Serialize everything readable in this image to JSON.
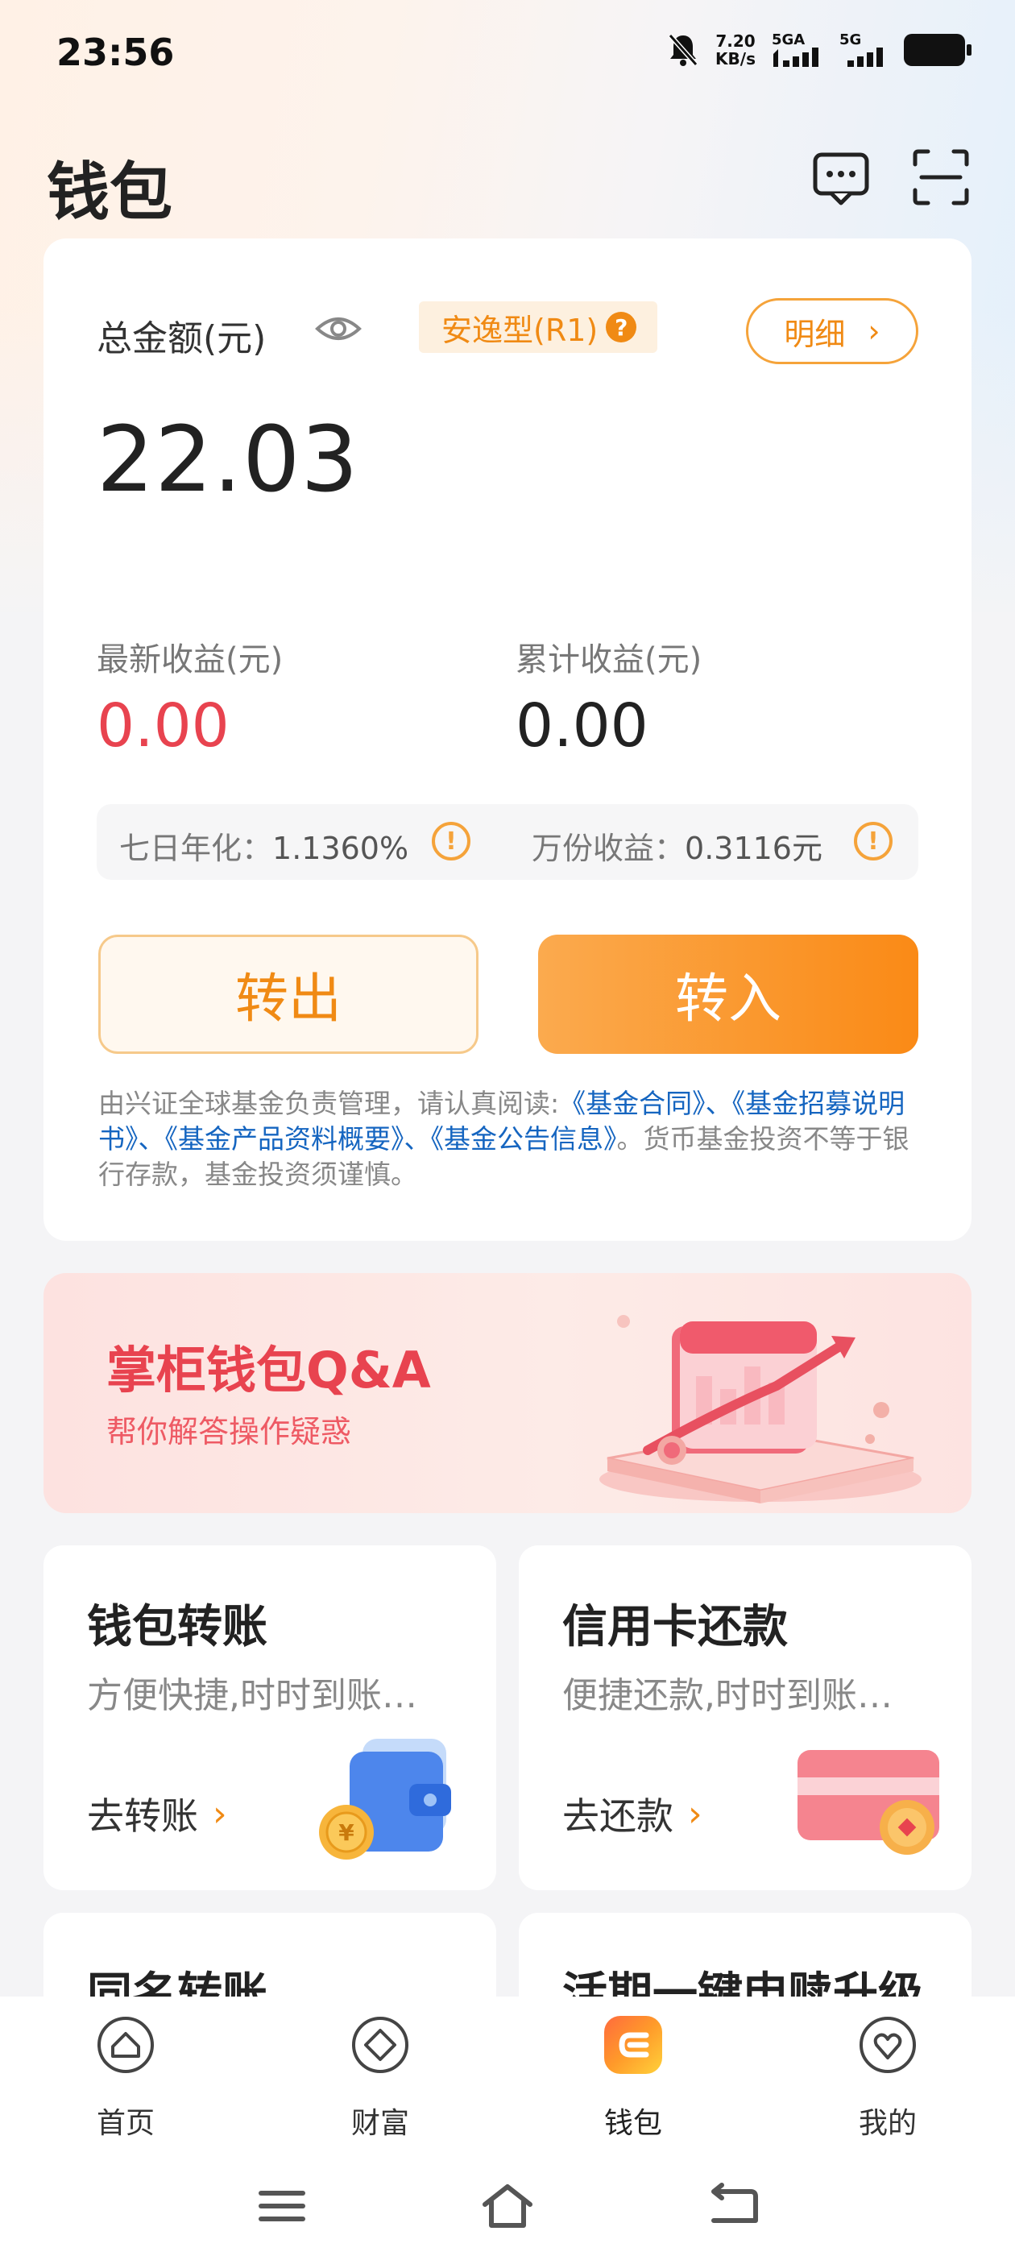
{
  "status": {
    "time": "23:56",
    "net_speed_value": "7.20",
    "net_speed_unit": "KB/s",
    "sim1": "5GA",
    "sim2": "5G"
  },
  "header": {
    "title": "钱包",
    "message_icon": "message-icon",
    "scan_icon": "scan-icon"
  },
  "balance": {
    "total_label": "总金额(元)",
    "risk_tag": "安逸型(R1)",
    "risk_help": "?",
    "detail_label": "明细",
    "detail_chevron": "›",
    "total_amount": "22.03",
    "latest_label": "最新收益(元)",
    "latest_value": "0.00",
    "cumulative_label": "累计收益(元)",
    "cumulative_value": "0.00",
    "seven_day_label": "七日年化：",
    "seven_day_value": "1.1360%",
    "per_10k_label": "万份收益：",
    "per_10k_value": "0.3116元",
    "warn": "!",
    "transfer_out": "转出",
    "transfer_in": "转入",
    "disclaimer_prefix": "由兴证全球基金负责管理，请认真阅读:",
    "doc_contract": "《基金合同》",
    "sep1": "、",
    "doc_prospectus": "《基金招募说明书》",
    "sep2": "、",
    "doc_summary": "《基金产品资料概要》",
    "sep3": "、",
    "doc_notice": "《基金公告信息》",
    "disclaimer_suffix": "。货币基金投资不等于银行存款，基金投资须谨慎。"
  },
  "qa_banner": {
    "title": "掌柜钱包Q&A",
    "subtitle": "帮你解答操作疑惑"
  },
  "tiles": [
    {
      "title": "钱包转账",
      "subtitle": "方便快捷,时时到账…",
      "link": "去转账",
      "chevron": "›"
    },
    {
      "title": "信用卡还款",
      "subtitle": "便捷还款,时时到账…",
      "link": "去还款",
      "chevron": "›"
    },
    {
      "title": "同名转账"
    },
    {
      "title": "活期一键申赎升级"
    }
  ],
  "nav": [
    {
      "label": "首页",
      "icon": "home-icon"
    },
    {
      "label": "财富",
      "icon": "wealth-icon"
    },
    {
      "label": "钱包",
      "icon": "wallet-icon"
    },
    {
      "label": "我的",
      "icon": "profile-icon"
    }
  ],
  "colors": {
    "accent": "#f08a14",
    "negative_red": "#e8434f",
    "link_blue": "#1565c0"
  }
}
